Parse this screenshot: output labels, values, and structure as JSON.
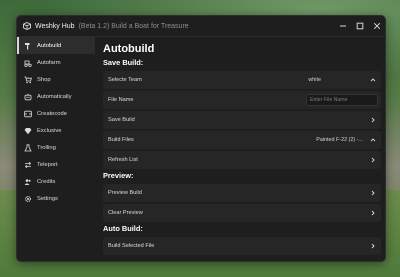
{
  "window": {
    "title": "Weshky Hub",
    "subtitle": "(Beta 1.2) Build a Boat for Treasure"
  },
  "sidebar": {
    "items": [
      {
        "label": "Autobuild",
        "icon": "hammer-icon",
        "active": true
      },
      {
        "label": "Autofarm",
        "icon": "tractor-icon"
      },
      {
        "label": "Shop",
        "icon": "cart-icon"
      },
      {
        "label": "Automatically",
        "icon": "robot-icon"
      },
      {
        "label": "Createcode",
        "icon": "code-icon"
      },
      {
        "label": "Exclusive",
        "icon": "diamond-icon"
      },
      {
        "label": "Trolling",
        "icon": "flask-icon"
      },
      {
        "label": "Teleport",
        "icon": "teleport-icon"
      },
      {
        "label": "Credits",
        "icon": "users-icon"
      },
      {
        "label": "Settings",
        "icon": "gear-icon"
      }
    ]
  },
  "main": {
    "page_title": "Autobuild",
    "save_build": {
      "heading": "Save Build:",
      "select_team_label": "Selecte Team",
      "select_team_value": "white",
      "file_name_label": "File Name",
      "file_name_placeholder": "Enter File Name",
      "save_build_label": "Save Build",
      "build_files_label": "Build Files",
      "build_files_value": "Painted F-22 (2) -...",
      "refresh_list_label": "Refresh List"
    },
    "preview": {
      "heading": "Preview:",
      "preview_build_label": "Preview Build",
      "clear_preview_label": "Clear Preview"
    },
    "auto_build": {
      "heading": "Auto Build:",
      "build_selected_label": "Build Selected File"
    }
  },
  "colors": {
    "window_bg": "#1e1e1e",
    "row_bg": "#262626",
    "active_nav_bg": "#2d2d2d"
  }
}
